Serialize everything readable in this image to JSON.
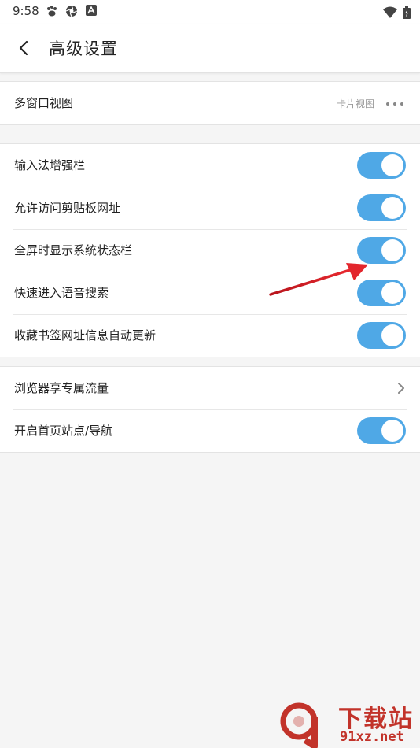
{
  "status_bar": {
    "time": "9:58"
  },
  "header": {
    "title": "高级设置"
  },
  "group1": {
    "rows": [
      {
        "label": "多窗口视图",
        "value": "卡片视图"
      }
    ]
  },
  "group2": {
    "rows": [
      {
        "label": "输入法增强栏",
        "on": true
      },
      {
        "label": "允许访问剪贴板网址",
        "on": true
      },
      {
        "label": "全屏时显示系统状态栏",
        "on": true
      },
      {
        "label": "快速进入语音搜索",
        "on": true
      },
      {
        "label": "收藏书签网址信息自动更新",
        "on": true
      }
    ]
  },
  "group3": {
    "rows": [
      {
        "label": "浏览器享专属流量"
      },
      {
        "label": "开启首页站点/导航",
        "on": true
      }
    ]
  },
  "watermark": {
    "logo_text": "9",
    "title": "下载站",
    "site": "91xz.net"
  },
  "colors": {
    "accent": "#4fa8e6",
    "arrow": "#d8202a",
    "watermark": "#c2332a"
  }
}
